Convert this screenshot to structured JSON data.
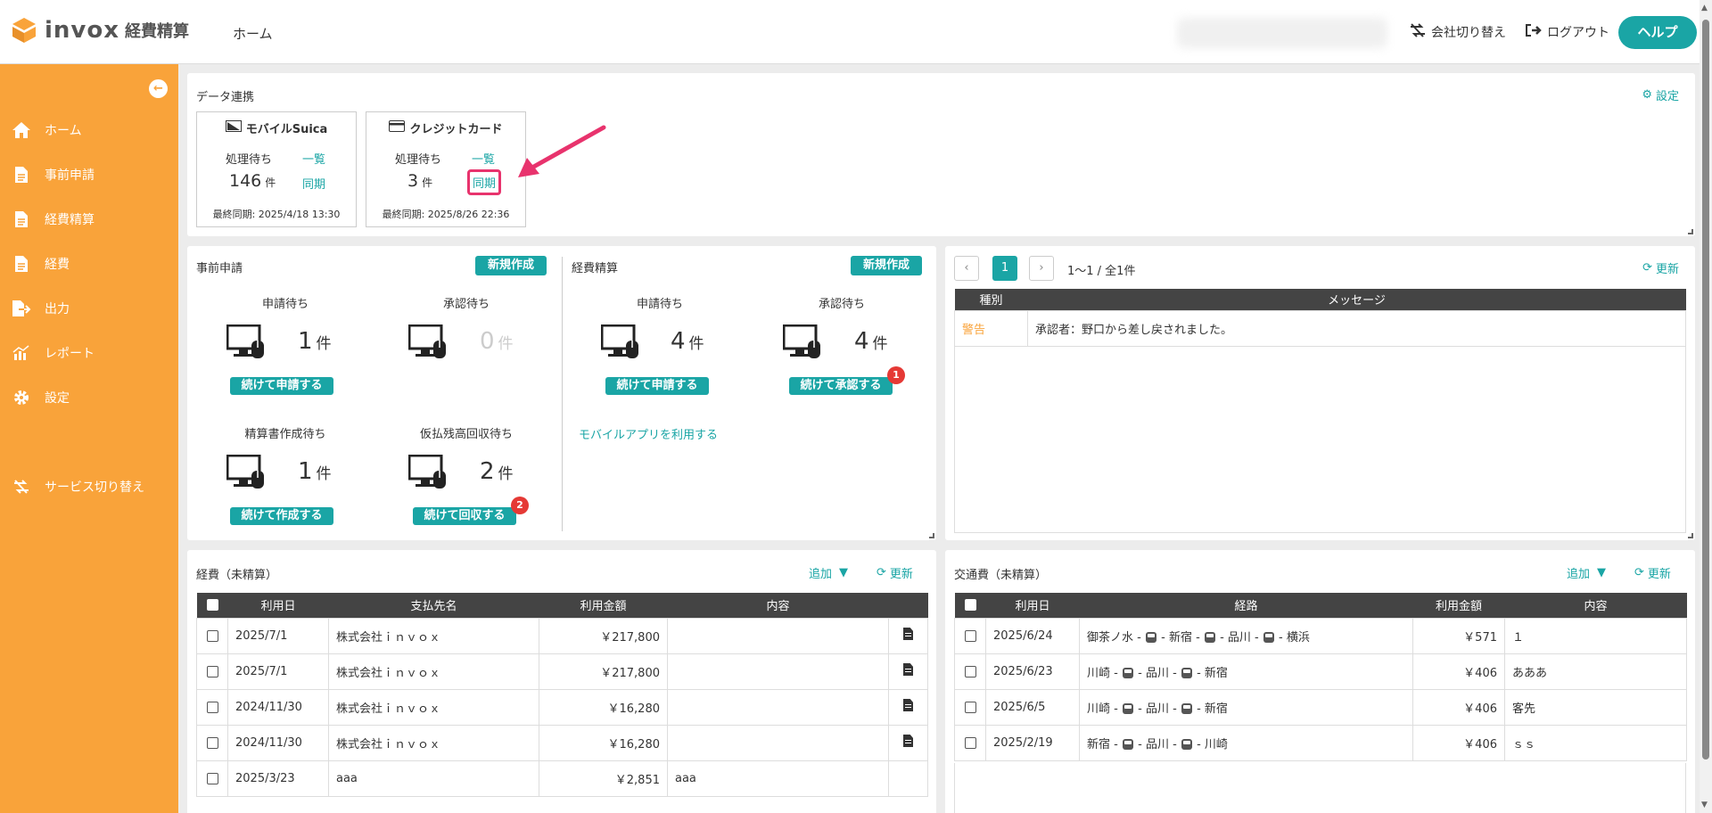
{
  "header": {
    "logo_text": "invox",
    "logo_sub": "経費精算",
    "nav_home": "ホーム",
    "switch_company": "会社切り替え",
    "logout": "ログアウト",
    "help": "ヘルプ"
  },
  "sidebar": {
    "items": [
      {
        "label": "ホーム",
        "icon": "home-icon"
      },
      {
        "label": "事前申請",
        "icon": "document-icon"
      },
      {
        "label": "経費精算",
        "icon": "document-icon"
      },
      {
        "label": "経費",
        "icon": "document-icon"
      },
      {
        "label": "出力",
        "icon": "export-icon"
      },
      {
        "label": "レポート",
        "icon": "report-icon"
      },
      {
        "label": "設定",
        "icon": "gear-icon"
      },
      {
        "label": "サービス切り替え",
        "icon": "switch-icon"
      }
    ]
  },
  "data_link": {
    "title": "データ連携",
    "settings": "設定",
    "suica": {
      "title": "モバイルSuica",
      "pending_label": "処理待ち",
      "count": "146",
      "unit": "件",
      "list": "一覧",
      "sync": "同期",
      "last_sync": "最終同期: 2025/4/18 13:30"
    },
    "card": {
      "title": "クレジットカード",
      "pending_label": "処理待ち",
      "count": "3",
      "unit": "件",
      "list": "一覧",
      "sync": "同期",
      "last_sync": "最終同期: 2025/8/26 22:36"
    }
  },
  "pre_application": {
    "title": "事前申請",
    "new": "新規作成",
    "apply_wait": {
      "label": "申請待ち",
      "count": "1",
      "unit": "件",
      "button": "続けて申請する"
    },
    "approve_wait": {
      "label": "承認待ち",
      "count": "0",
      "unit": "件"
    },
    "settle_wait": {
      "label": "精算書作成待ち",
      "count": "1",
      "unit": "件",
      "button": "続けて作成する"
    },
    "advance_wait": {
      "label": "仮払残高回収待ち",
      "count": "2",
      "unit": "件",
      "button": "続けて回収する",
      "badge": "2"
    }
  },
  "expense_settlement": {
    "title": "経費精算",
    "new": "新規作成",
    "apply_wait": {
      "label": "申請待ち",
      "count": "4",
      "unit": "件",
      "button": "続けて申請する"
    },
    "approve_wait": {
      "label": "承認待ち",
      "count": "4",
      "unit": "件",
      "button": "続けて承認する",
      "badge": "1"
    },
    "mobile_link": "モバイルアプリを利用する"
  },
  "messages": {
    "page": "1",
    "range": "1〜1 / 全1件",
    "refresh": "更新",
    "col_type": "種別",
    "col_message": "メッセージ",
    "rows": [
      {
        "type": "警告",
        "message": "承認者：野口から差し戻されました。"
      }
    ]
  },
  "expenses": {
    "title": "経費（未精算）",
    "add": "追加",
    "refresh": "更新",
    "columns": [
      "利用日",
      "支払先名",
      "利用金額",
      "内容"
    ],
    "rows": [
      {
        "date": "2025/7/1",
        "payee": "株式会社ｉｎｖｏｘ",
        "amount": "￥217,800",
        "content": "",
        "doc": true
      },
      {
        "date": "2025/7/1",
        "payee": "株式会社ｉｎｖｏｘ",
        "amount": "￥217,800",
        "content": "",
        "doc": true
      },
      {
        "date": "2024/11/30",
        "payee": "株式会社ｉｎｖｏｘ",
        "amount": "￥16,280",
        "content": "",
        "doc": true
      },
      {
        "date": "2024/11/30",
        "payee": "株式会社ｉｎｖｏｘ",
        "amount": "￥16,280",
        "content": "",
        "doc": true
      },
      {
        "date": "2025/3/23",
        "payee": "aaa",
        "amount": "￥2,851",
        "content": "aaa",
        "doc": false
      }
    ]
  },
  "transport": {
    "title": "交通費（未精算）",
    "add": "追加",
    "refresh": "更新",
    "columns": [
      "利用日",
      "経路",
      "利用金額",
      "内容"
    ],
    "rows": [
      {
        "date": "2025/6/24",
        "route": [
          "御茶ノ水",
          "新宿",
          "品川",
          "横浜"
        ],
        "amount": "￥571",
        "content": "１"
      },
      {
        "date": "2025/6/23",
        "route": [
          "川崎",
          "品川",
          "新宿"
        ],
        "amount": "￥406",
        "content": "あああ"
      },
      {
        "date": "2025/6/5",
        "route": [
          "川崎",
          "品川",
          "新宿"
        ],
        "amount": "￥406",
        "content": "客先"
      },
      {
        "date": "2025/2/19",
        "route": [
          "新宿",
          "品川",
          "川崎"
        ],
        "amount": "￥406",
        "content": "ｓｓ"
      }
    ]
  },
  "colors": {
    "accent": "#1aa5a5",
    "sidebar": "#f9a33a",
    "warning": "#f9a33a",
    "badge": "#e53935",
    "highlight": "#e8336d"
  }
}
